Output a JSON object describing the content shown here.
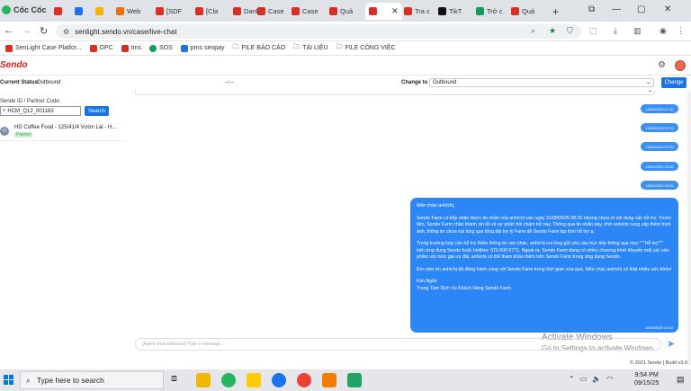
{
  "browser": {
    "brand": "Cốc Cốc",
    "tabs": [
      {
        "label": "",
        "color": "#d93025"
      },
      {
        "label": "",
        "color": "#1a73e8"
      },
      {
        "label": "",
        "color": "#f4b400"
      },
      {
        "label": "Web",
        "color": "#e8710a"
      },
      {
        "label": "[SDF",
        "color": "#d93025"
      },
      {
        "label": "[Cla",
        "color": "#d93025"
      },
      {
        "label": "Danh",
        "color": "#d93025"
      },
      {
        "label": "Case",
        "color": "#d93025"
      },
      {
        "label": "Case",
        "color": "#d93025"
      },
      {
        "label": "Quả",
        "color": "#d93025"
      },
      {
        "label": "",
        "color": "#d93025"
      },
      {
        "label": "Tra c",
        "color": "#d93025"
      },
      {
        "label": "TikT",
        "color": "#111111"
      },
      {
        "label": "Trở c",
        "color": "#0f9d58"
      },
      {
        "label": "Quả",
        "color": "#d93025"
      }
    ],
    "url": "senlight.sendo.vn/case/live-chat",
    "bookmarks": [
      "SenLight Case Platfor...",
      "OPC",
      "tms",
      "SOS",
      "pms senpay",
      "FILE BÁO CÁO",
      "TÀI LIỆU",
      "FILE CÔNG VIỆC"
    ]
  },
  "app": {
    "logo": "Sendo",
    "status_label": "Current Status:",
    "status_value": "Outbound",
    "status_mid": "--:--",
    "change_to_label": "Change to",
    "change_to_value": "Outbound",
    "change_button": "Change",
    "search_label": "Sendo ID / Partner Code:",
    "search_value": "HCM_Q12_001163",
    "search_button": "Search",
    "conversation": {
      "avatar_text": "H",
      "name": "HD Coffee Food - 125/41/4 Vườn Lài - H...",
      "tag": "Partner"
    },
    "timestamps": [
      "15/09/2025 07:30",
      "15/09/2025 07:33",
      "15/09/2025 07:39",
      "15/09/2025 15:05",
      "15/09/2025 15:05"
    ],
    "message": {
      "greeting": "Mến chào anh/chị,",
      "para1": "Sendo Farm có tiếp nhận được tin nhắn của anh/chị vào ngày 31/08/2025 08:25 nhưng chưa rõ nội dung cần hỗ trợ. Trước tiên, Sendo Farm chân thành xin lỗi về sự phản hồi chậm trễ này. Thông qua tin nhắn này, nhờ anh/chị cung cấp thêm hình ảnh, thông tin chưa hài lòng qua tổng đài trợ lý Farm để Sendo Farm kịp thời hỗ trợ ạ.",
      "para2": "Trong trường hợp cần hỗ trợ thêm thông tin nào khác, anh/chị vui lòng gửi yêu cầu trực tiếp thông qua mục \"\"\"Hỗ trợ\"\"\" trên ứng dụng Sendo hoặc Hotline: 076 600 6771. Ngoài ra, Sendo Farm đang có nhiều chương trình khuyến mãi các sản phẩm với mức giá ưu đãi, anh/chị có thể tham khảo thêm trên Sendo Farm trong ứng dụng Sendo.",
      "para3": "Em cảm ơn anh/chị đã đồng hành cùng với Sendo Farm trong thời gian vừa qua. Mến chúc anh/chị có thật nhiều sức khỏe!",
      "sign1": "Kim Ngân",
      "sign2": "Trung Tâm Dịch Vụ Khách Hàng Sendo Farm",
      "time": "15/09/2025 21:53"
    },
    "input_placeholder": "[Agent chat outbound] Type a message...",
    "footer": "© 2021 Sendo | Build v3.0"
  },
  "watermark": {
    "line1": "Activate Windows",
    "line2": "Go to Settings to activate Windows."
  },
  "taskbar": {
    "search_placeholder": "Type here to search",
    "time": "9:54 PM",
    "date": "09/15/25"
  }
}
